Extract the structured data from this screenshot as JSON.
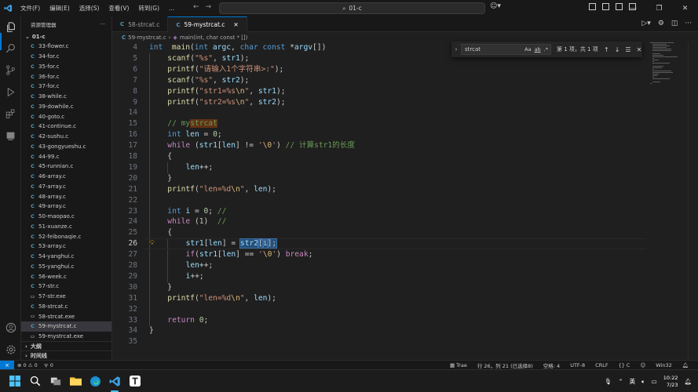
{
  "titlebar": {
    "menu": [
      "文件(F)",
      "编辑(E)",
      "选择(S)",
      "查看(V)",
      "转到(G)",
      "..."
    ],
    "search_text": "01-c"
  },
  "explorer": {
    "header": "资源管理器",
    "folder": "01-c",
    "files": [
      {
        "name": "33-flower.c",
        "type": "c"
      },
      {
        "name": "34-for.c",
        "type": "c"
      },
      {
        "name": "35-for.c",
        "type": "c"
      },
      {
        "name": "36-for.c",
        "type": "c"
      },
      {
        "name": "37-for.c",
        "type": "c"
      },
      {
        "name": "38-while.c",
        "type": "c"
      },
      {
        "name": "39-dowhile.c",
        "type": "c"
      },
      {
        "name": "40-goto.c",
        "type": "c"
      },
      {
        "name": "41-continue.c",
        "type": "c"
      },
      {
        "name": "42-sushu.c",
        "type": "c"
      },
      {
        "name": "43-gongyueshu.c",
        "type": "c"
      },
      {
        "name": "44-99.c",
        "type": "c"
      },
      {
        "name": "45-runnian.c",
        "type": "c"
      },
      {
        "name": "46-array.c",
        "type": "c"
      },
      {
        "name": "47-array.c",
        "type": "c"
      },
      {
        "name": "48-array.c",
        "type": "c"
      },
      {
        "name": "49-array.c",
        "type": "c"
      },
      {
        "name": "50-maopao.c",
        "type": "c"
      },
      {
        "name": "51-xuanze.c",
        "type": "c"
      },
      {
        "name": "52-feibonaqie.c",
        "type": "c"
      },
      {
        "name": "53-array.c",
        "type": "c"
      },
      {
        "name": "54-yanghui.c",
        "type": "c"
      },
      {
        "name": "55-yanghui.c",
        "type": "c"
      },
      {
        "name": "56-week.c",
        "type": "c"
      },
      {
        "name": "57-str.c",
        "type": "c"
      },
      {
        "name": "57-str.exe",
        "type": "exe"
      },
      {
        "name": "58-strcat.c",
        "type": "c"
      },
      {
        "name": "58-strcat.exe",
        "type": "exe"
      },
      {
        "name": "59-mystrcat.c",
        "type": "c",
        "selected": true
      },
      {
        "name": "59-mystrcat.exe",
        "type": "exe"
      }
    ],
    "outline": "大纲",
    "timeline": "时间线"
  },
  "tabs": [
    {
      "label": "58-strcat.c",
      "active": false
    },
    {
      "label": "59-mystrcat.c",
      "active": true
    }
  ],
  "breadcrumb": {
    "file": "59-mystrcat.c",
    "symbol": "main(int, char const * [])"
  },
  "find": {
    "query": "strcat",
    "opt_case": "Aa",
    "opt_word": "ab",
    "opt_regex": ".*",
    "count": "第 1 项，共 1 项"
  },
  "editor": {
    "current_line": 26,
    "lines": [
      {
        "n": 4,
        "indent": 0,
        "t": [
          [
            "kw",
            "int"
          ],
          [
            "",
            "  "
          ],
          [
            "fn",
            "main"
          ],
          [
            "",
            "("
          ],
          [
            "kw",
            "int"
          ],
          [
            "",
            " "
          ],
          [
            "var",
            "argc"
          ],
          [
            "",
            ", "
          ],
          [
            "kw",
            "char"
          ],
          [
            "",
            " "
          ],
          [
            "kw",
            "const"
          ],
          [
            "",
            " *"
          ],
          [
            "var",
            "argv"
          ],
          [
            "",
            "[])"
          ]
        ]
      },
      {
        "n": 5,
        "indent": 1,
        "t": [
          [
            "fn",
            "scanf"
          ],
          [
            "",
            "("
          ],
          [
            "str",
            "\"%s\""
          ],
          [
            "",
            ", "
          ],
          [
            "var",
            "str1"
          ],
          [
            "",
            ");"
          ]
        ]
      },
      {
        "n": 6,
        "indent": 1,
        "t": [
          [
            "fn",
            "printf"
          ],
          [
            "",
            "("
          ],
          [
            "str",
            "\"请输入1个字符串>:\""
          ],
          [
            "",
            ");"
          ]
        ]
      },
      {
        "n": 7,
        "indent": 1,
        "t": [
          [
            "fn",
            "scanf"
          ],
          [
            "",
            "("
          ],
          [
            "str",
            "\"%s\""
          ],
          [
            "",
            ", "
          ],
          [
            "var",
            "str2"
          ],
          [
            "",
            ");"
          ]
        ]
      },
      {
        "n": 8,
        "indent": 1,
        "t": [
          [
            "fn",
            "printf"
          ],
          [
            "",
            "("
          ],
          [
            "str",
            "\"str1=%s"
          ],
          [
            "esc",
            "\\n"
          ],
          [
            "str",
            "\""
          ],
          [
            "",
            ", "
          ],
          [
            "var",
            "str1"
          ],
          [
            "",
            ");"
          ]
        ]
      },
      {
        "n": 9,
        "indent": 1,
        "t": [
          [
            "fn",
            "printf"
          ],
          [
            "",
            "("
          ],
          [
            "str",
            "\"str2=%s"
          ],
          [
            "esc",
            "\\n"
          ],
          [
            "str",
            "\""
          ],
          [
            "",
            ", "
          ],
          [
            "var",
            "str2"
          ],
          [
            "",
            ");"
          ]
        ]
      },
      {
        "n": 14,
        "indent": 0,
        "t": []
      },
      {
        "n": 15,
        "indent": 1,
        "t": [
          [
            "cm",
            "// my"
          ],
          [
            "cm hl",
            "strcat"
          ]
        ]
      },
      {
        "n": 16,
        "indent": 1,
        "t": [
          [
            "kw",
            "int"
          ],
          [
            "",
            " "
          ],
          [
            "var",
            "len"
          ],
          [
            "",
            " = "
          ],
          [
            "num",
            "0"
          ],
          [
            "",
            ";"
          ]
        ]
      },
      {
        "n": 17,
        "indent": 1,
        "t": [
          [
            "cfl",
            "while"
          ],
          [
            "",
            " ("
          ],
          [
            "var",
            "str1"
          ],
          [
            "",
            "["
          ],
          [
            "var",
            "len"
          ],
          [
            "",
            "] != "
          ],
          [
            "str",
            "'"
          ],
          [
            "esc",
            "\\0"
          ],
          [
            "str",
            "'"
          ],
          [
            "",
            ") "
          ],
          [
            "cm",
            "// 计算str1的长度"
          ]
        ]
      },
      {
        "n": 18,
        "indent": 1,
        "t": [
          [
            "",
            "{"
          ]
        ]
      },
      {
        "n": 19,
        "indent": 2,
        "t": [
          [
            "var",
            "len"
          ],
          [
            "",
            "++;"
          ]
        ]
      },
      {
        "n": 20,
        "indent": 1,
        "t": [
          [
            "",
            "}"
          ]
        ]
      },
      {
        "n": 21,
        "indent": 1,
        "t": [
          [
            "fn",
            "printf"
          ],
          [
            "",
            "("
          ],
          [
            "str",
            "\"len=%d"
          ],
          [
            "esc",
            "\\n"
          ],
          [
            "str",
            "\""
          ],
          [
            "",
            ", "
          ],
          [
            "var",
            "len"
          ],
          [
            "",
            ");"
          ]
        ]
      },
      {
        "n": 22,
        "indent": 0,
        "t": []
      },
      {
        "n": 23,
        "indent": 1,
        "t": [
          [
            "kw",
            "int"
          ],
          [
            "",
            " "
          ],
          [
            "var",
            "i"
          ],
          [
            "",
            " = "
          ],
          [
            "num",
            "0"
          ],
          [
            "",
            "; "
          ],
          [
            "cm",
            "//"
          ]
        ]
      },
      {
        "n": 24,
        "indent": 1,
        "t": [
          [
            "cfl",
            "while"
          ],
          [
            "",
            " ("
          ],
          [
            "num",
            "1"
          ],
          [
            "",
            ")  "
          ],
          [
            "cm",
            "//"
          ]
        ]
      },
      {
        "n": 25,
        "indent": 1,
        "t": [
          [
            "",
            "{"
          ]
        ]
      },
      {
        "n": 26,
        "indent": 2,
        "t": [
          [
            "var",
            "str1"
          ],
          [
            "",
            "["
          ],
          [
            "var",
            "len"
          ],
          [
            "",
            "] = "
          ],
          [
            "var sel",
            "str2"
          ],
          [
            "sel",
            "["
          ],
          [
            "var sel",
            "i"
          ],
          [
            "sel",
            "];"
          ]
        ]
      },
      {
        "n": 27,
        "indent": 2,
        "t": [
          [
            "cfl",
            "if"
          ],
          [
            "",
            "("
          ],
          [
            "var",
            "str1"
          ],
          [
            "",
            "["
          ],
          [
            "var",
            "len"
          ],
          [
            "",
            "] == "
          ],
          [
            "str",
            "'"
          ],
          [
            "esc",
            "\\0"
          ],
          [
            "str",
            "'"
          ],
          [
            "",
            ") "
          ],
          [
            "cfl",
            "break"
          ],
          [
            "",
            ";"
          ]
        ]
      },
      {
        "n": 28,
        "indent": 2,
        "t": [
          [
            "var",
            "len"
          ],
          [
            "",
            "++;"
          ]
        ]
      },
      {
        "n": 29,
        "indent": 2,
        "t": [
          [
            "var",
            "i"
          ],
          [
            "",
            "++;"
          ]
        ]
      },
      {
        "n": 30,
        "indent": 1,
        "t": [
          [
            "",
            "}"
          ]
        ]
      },
      {
        "n": 31,
        "indent": 1,
        "t": [
          [
            "fn",
            "printf"
          ],
          [
            "",
            "("
          ],
          [
            "str",
            "\"len=%d"
          ],
          [
            "esc",
            "\\n"
          ],
          [
            "str",
            "\""
          ],
          [
            "",
            ", "
          ],
          [
            "var",
            "len"
          ],
          [
            "",
            ");"
          ]
        ]
      },
      {
        "n": 32,
        "indent": 0,
        "t": []
      },
      {
        "n": 33,
        "indent": 1,
        "t": [
          [
            "cfl",
            "return"
          ],
          [
            "",
            " "
          ],
          [
            "num",
            "0"
          ],
          [
            "",
            ";"
          ]
        ]
      },
      {
        "n": 34,
        "indent": 0,
        "t": [
          [
            "",
            "}"
          ]
        ]
      },
      {
        "n": 35,
        "indent": 0,
        "t": []
      }
    ]
  },
  "statusbar": {
    "problems": "⊗ 0 ⚠ 0",
    "warn_count": "0",
    "trae": "Trae",
    "position": "行 26，列 21 (已选择8)",
    "spaces": "空格: 4",
    "encoding": "UTF-8",
    "eol": "CRLF",
    "lang": "{} C",
    "platform": "Win32"
  },
  "taskbar": {
    "ime": "英",
    "time": "10:22",
    "date": "7/23"
  },
  "colors": {
    "accent": "#0078d4",
    "editor_bg": "#1f1f1f",
    "sidebar_bg": "#181818"
  }
}
